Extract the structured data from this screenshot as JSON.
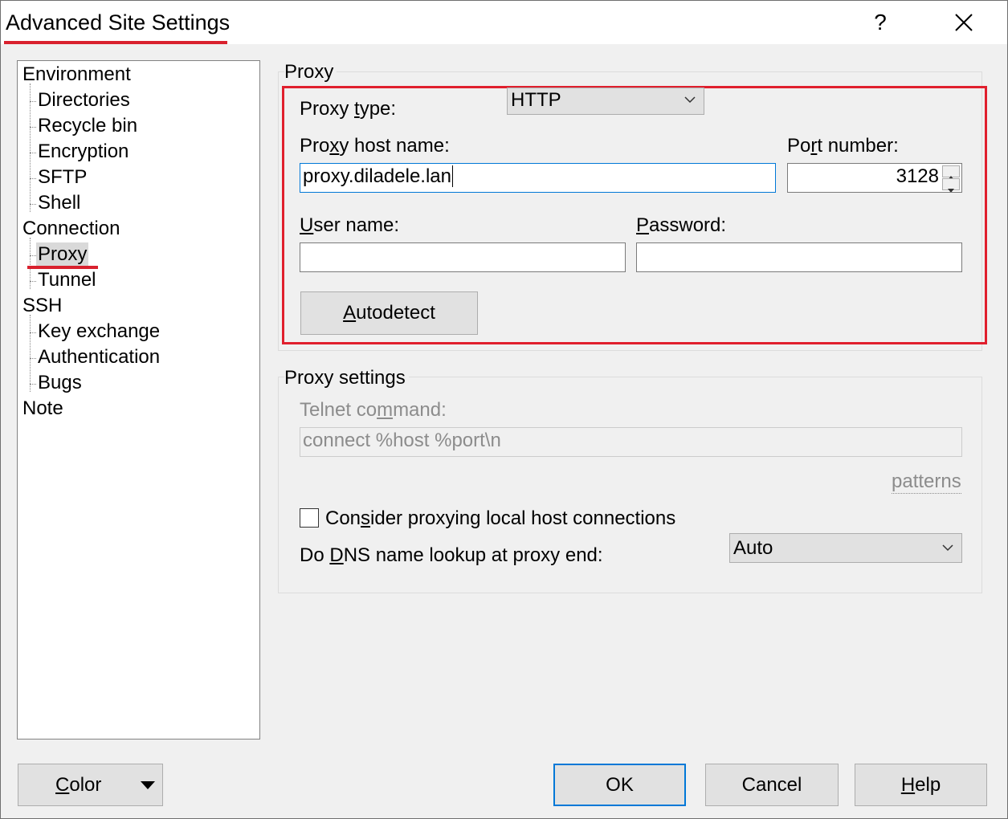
{
  "window": {
    "title": "Advanced Site Settings",
    "help_glyph": "?"
  },
  "tree": {
    "items": [
      {
        "label": "Environment",
        "level": 0
      },
      {
        "label": "Directories",
        "level": 1
      },
      {
        "label": "Recycle bin",
        "level": 1
      },
      {
        "label": "Encryption",
        "level": 1
      },
      {
        "label": "SFTP",
        "level": 1
      },
      {
        "label": "Shell",
        "level": 1
      },
      {
        "label": "Connection",
        "level": 0
      },
      {
        "label": "Proxy",
        "level": 1,
        "selected": true
      },
      {
        "label": "Tunnel",
        "level": 1
      },
      {
        "label": "SSH",
        "level": 0
      },
      {
        "label": "Key exchange",
        "level": 1
      },
      {
        "label": "Authentication",
        "level": 1
      },
      {
        "label": "Bugs",
        "level": 1
      },
      {
        "label": "Note",
        "level": 0
      }
    ]
  },
  "proxy": {
    "group_label": "Proxy",
    "type_label_pre": "Proxy ",
    "type_label_key": "t",
    "type_label_post": "ype:",
    "type_value": "HTTP",
    "host_label_pre": "Pro",
    "host_label_key": "x",
    "host_label_post": "y host name:",
    "host_value": "proxy.diladele.lan",
    "port_label_pre": "Po",
    "port_label_key": "r",
    "port_label_post": "t number:",
    "port_value": "3128",
    "user_label_key": "U",
    "user_label_post": "ser name:",
    "user_value": "",
    "password_label_key": "P",
    "password_label_post": "assword:",
    "password_value": "",
    "autodetect_key": "A",
    "autodetect_post": "utodetect"
  },
  "proxy_settings": {
    "group_label": "Proxy settings",
    "telnet_label_pre": "Telnet co",
    "telnet_label_key": "m",
    "telnet_label_post": "mand:",
    "telnet_value": "connect %host %port\\n",
    "patterns_link": "patterns",
    "consider_label_pre": "Con",
    "consider_label_key": "s",
    "consider_label_post": "ider proxying local host connections",
    "consider_checked": false,
    "dns_label_pre": "Do ",
    "dns_label_key": "D",
    "dns_label_post": "NS name lookup at proxy end:",
    "dns_value": "Auto"
  },
  "footer": {
    "color_key": "C",
    "color_post": "olor",
    "ok_label": "OK",
    "cancel_label": "Cancel",
    "help_key": "H",
    "help_post": "elp"
  },
  "colors": {
    "highlight": "#d9212e",
    "focus": "#0078d7",
    "face": "#f0f0f0"
  }
}
